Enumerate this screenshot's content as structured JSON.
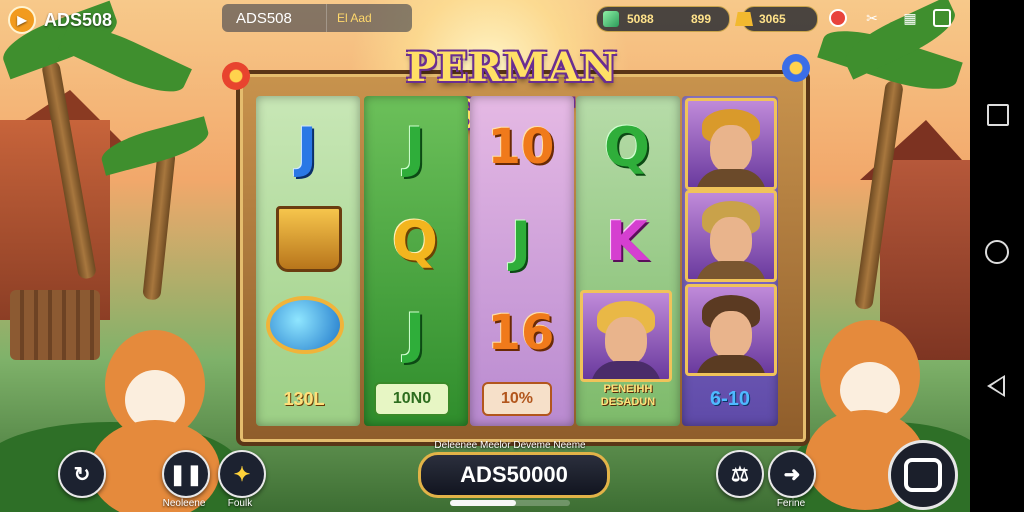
{
  "header": {
    "brand_name": "ADS508",
    "title_primary": "ADS508",
    "title_secondary": "El Aad",
    "stat_gems": "5088",
    "stat_multiplier": "899",
    "stat_gold": "3065"
  },
  "game": {
    "title": "PERMAN SLOT",
    "reels": [
      {
        "symbols": [
          "J",
          "treasure-cup",
          "goggles"
        ],
        "label": "130L"
      },
      {
        "symbols": [
          "J",
          "Q",
          "J"
        ],
        "label": "10N0"
      },
      {
        "symbols": [
          "10",
          "J",
          "16"
        ],
        "label": "10%"
      },
      {
        "symbols": [
          "Q",
          "K",
          "portrait"
        ],
        "label_line1": "PENEIHH",
        "label_line2": "DESADUN"
      },
      {
        "symbols": [
          "portrait",
          "portrait",
          "portrait"
        ],
        "label": "6-10"
      }
    ]
  },
  "controls": {
    "left_buttons": [
      {
        "icon": "refresh-icon",
        "caption": ""
      },
      {
        "icon": "pause-icon",
        "caption": "Neoleene"
      },
      {
        "icon": "star-icon",
        "caption": "Foulk"
      }
    ],
    "credit_caption": "Deleenee Meelor Deveme Neeme",
    "credit_value": "ADS50000",
    "progress_fraction": 0.55,
    "right_buttons": [
      {
        "icon": "bet-settings-icon",
        "caption": ""
      },
      {
        "icon": "arrow-right-icon",
        "caption": "Ferine"
      }
    ]
  },
  "colors": {
    "accent_gold": "#e2b348",
    "title_yellow": "#ffe066",
    "title_outline": "#6a2e91"
  }
}
